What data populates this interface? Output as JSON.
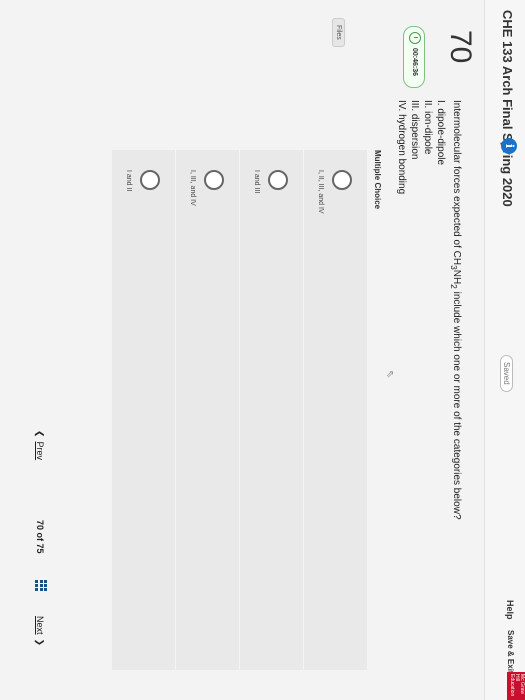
{
  "header": {
    "exam_title": "CHE 133 Arch Final Spring 2020",
    "info_icon": "i",
    "saved_label": "Saved",
    "help_label": "Help",
    "save_exit_label": "Save & Exit"
  },
  "question": {
    "number": "70",
    "timer": "00:46:36",
    "files_label": "Files",
    "stem_pre": "Intermolecular forces expected of CH",
    "stem_sub1": "3",
    "stem_mid": "NH",
    "stem_sub2": "2",
    "stem_post": " include which one or more of the categories below?",
    "options_list": [
      "I. dipole-dipole",
      "II. ion-dipole",
      "III. dispersion",
      "IV. hydrogen bonding"
    ],
    "type_label": "Multiple Choice",
    "choices": [
      "I, II, III, and IV",
      "I and III",
      "I, III, and IV",
      "I and II"
    ]
  },
  "footer": {
    "prev_label": "Prev",
    "page_current": "70",
    "page_of": "of",
    "page_total": "75",
    "next_label": "Next"
  },
  "brand": {
    "text": "Mc Graw Hill Education",
    "color": "#c8102e"
  }
}
